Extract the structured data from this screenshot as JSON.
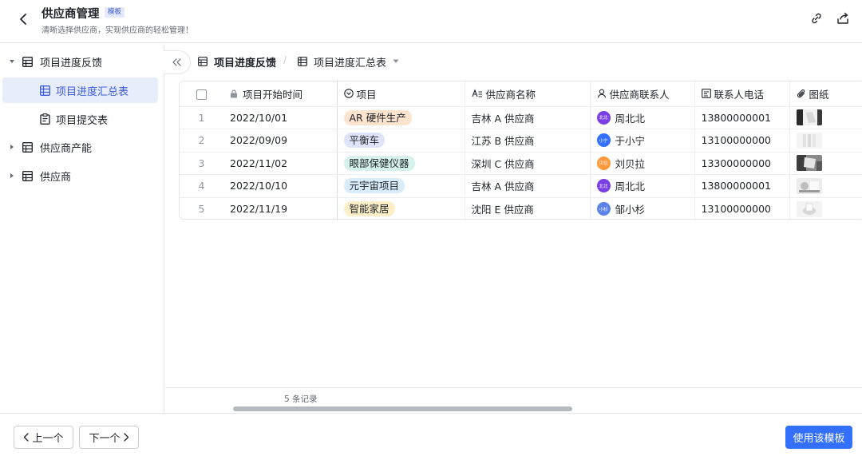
{
  "header": {
    "title": "供应商管理",
    "badge": "模板",
    "subtitle": "清晰选择供应商，实现供应商的轻松管理！"
  },
  "sidebar": {
    "items": [
      {
        "label": "项目进度反馈",
        "icon": "grid-table-icon",
        "expanded": true
      },
      {
        "label": "项目进度汇总表",
        "icon": "table-view-icon",
        "active": true
      },
      {
        "label": "项目提交表",
        "icon": "form-icon"
      },
      {
        "label": "供应商产能",
        "icon": "grid-table-icon",
        "expanded": false
      },
      {
        "label": "供应商",
        "icon": "grid-table-icon",
        "expanded": false
      }
    ]
  },
  "breadcrumb": {
    "table": "项目进度反馈",
    "view": "项目进度汇总表"
  },
  "table": {
    "columns": [
      "项目开始时间",
      "项目",
      "供应商名称",
      "供应商联系人",
      "联系人电话",
      "图纸"
    ],
    "rows": [
      {
        "num": "1",
        "date": "2022/10/01",
        "project": "AR 硬件生产",
        "supplier": "吉林 A 供应商",
        "contact": "周北北",
        "avatar": "北北",
        "phone": "13800000001"
      },
      {
        "num": "2",
        "date": "2022/09/09",
        "project": "平衡车",
        "supplier": "江苏 B 供应商",
        "contact": "于小宁",
        "avatar": "小宁",
        "phone": "13100000000"
      },
      {
        "num": "3",
        "date": "2022/11/02",
        "project": "眼部保健仪器",
        "supplier": "深圳 C 供应商",
        "contact": "刘贝拉",
        "avatar": "贝拉",
        "phone": "13300000000"
      },
      {
        "num": "4",
        "date": "2022/10/10",
        "project": "元宇宙项目",
        "supplier": "吉林 A 供应商",
        "contact": "周北北",
        "avatar": "北北",
        "phone": "13800000001"
      },
      {
        "num": "5",
        "date": "2022/11/19",
        "project": "智能家居",
        "supplier": "沈阳 E 供应商",
        "contact": "邹小杉",
        "avatar": "小杉",
        "phone": "13100000000"
      }
    ]
  },
  "colors": {
    "accent": "#3370ff",
    "active_bg": "#e8edfb",
    "tag_ar": "#fde4cf",
    "tag_balance": "#dde5fb",
    "tag_eye": "#d6f2ea",
    "tag_meta": "#d9ecfb",
    "tag_home": "#fdefc8",
    "avatar_purple": "#7b3fe4",
    "avatar_blue": "#3370ff",
    "avatar_orange": "#ff9a3c",
    "avatar_steel": "#5b82e8"
  },
  "footer": {
    "record_count": "5 条记录"
  },
  "actions": {
    "prev": "上一个",
    "next": "下一个",
    "use_template": "使用该模板"
  }
}
